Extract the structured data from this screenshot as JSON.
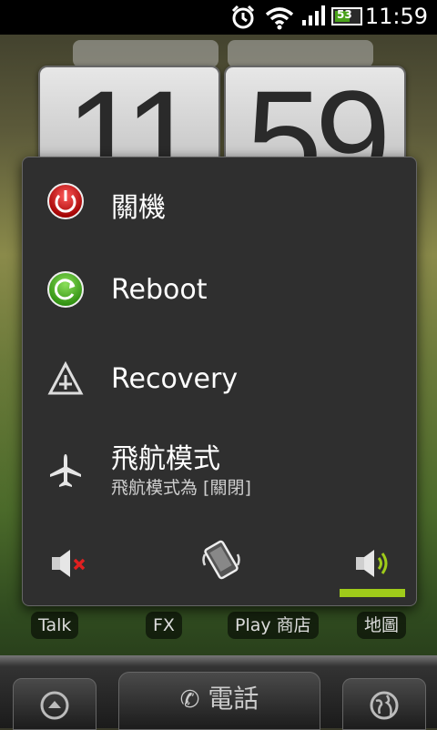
{
  "status_bar": {
    "time": "11:59",
    "battery": "53"
  },
  "clock_widget": {
    "hour": "11",
    "minute": "59"
  },
  "power_menu": {
    "items": [
      {
        "label": "關機"
      },
      {
        "label": "Reboot"
      },
      {
        "label": "Recovery"
      },
      {
        "label": "飛航模式",
        "sub": "飛航模式為 [關閉]"
      }
    ],
    "sound_modes": {
      "active": "sound-on",
      "active_color": "#9fcb1a"
    }
  },
  "dock_labels": [
    "Talk",
    "FX",
    "Play 商店",
    "地圖"
  ],
  "home_bar": {
    "phone_label": "電話"
  }
}
